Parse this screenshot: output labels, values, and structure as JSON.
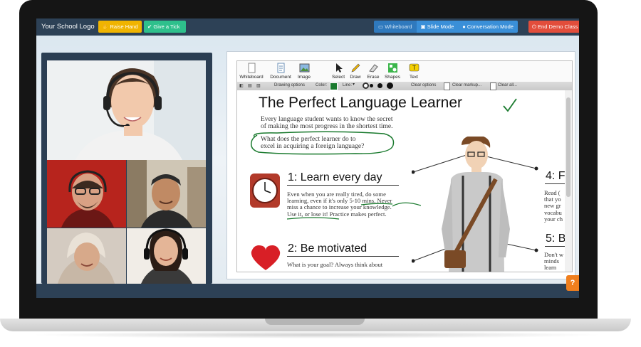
{
  "header": {
    "logo_text": "Your School Logo",
    "raise_hand": "Raise Hand",
    "give_tick": "Give a Tick",
    "modes": [
      "Whiteboard",
      "Slide Mode",
      "Conversation Mode"
    ],
    "end_demo": "End Demo Class"
  },
  "toolbar": {
    "tools": [
      "Whiteboard",
      "Document",
      "Image",
      "Select",
      "Draw",
      "Erase",
      "Shapes",
      "Text"
    ]
  },
  "options": {
    "drawing_options": "Drawing options",
    "color_label": "Color:",
    "line_label": "Line:",
    "clear_options": "Clear options",
    "clear_markup": "Clear markup...",
    "clear_all": "Clear all..."
  },
  "lesson": {
    "title": "The Perfect Language Learner",
    "intro_1": "Every language student wants to know the secret",
    "intro_2": "of making the most progress in the shortest time.",
    "question_1": "What does the perfect learner do to",
    "question_2": "excel in acquiring a foreign language?",
    "point1_heading": "1:  Learn every day",
    "point1_l1": "Even when you are really tired, do some",
    "point1_l2": "learning, even if it's only 5-10 mins. Never",
    "point1_l3": "miss a chance to increase your knowledge.",
    "point1_l4": "Use it, or lose it! Practice makes perfect.",
    "point2_heading": "2:  Be motivated",
    "point2_l1": "What is your goal? Always think about",
    "point4_heading": "4:  F",
    "point4_l1": "Read (",
    "point4_l2": "that yo",
    "point4_l3": "new gr",
    "point4_l4": "vocabu",
    "point4_l5": "your ch",
    "point5_heading": "5:  B",
    "point5_l1": "Don't w",
    "point5_l2": "minds",
    "point5_l3": "learn"
  },
  "colors": {
    "bar": "#2d4156",
    "raise": "#f0b400",
    "tick": "#2ec08c",
    "mode": "#3a8fd8",
    "end": "#e24d3b",
    "ink": "#1a7a2e",
    "help": "#f07f1e"
  }
}
